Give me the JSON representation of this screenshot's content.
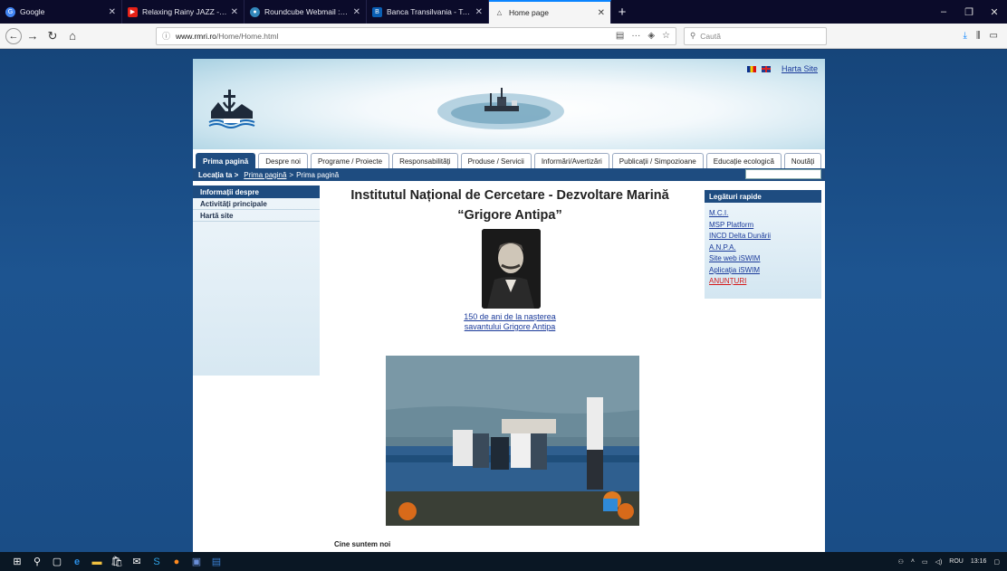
{
  "browser": {
    "tabs": [
      {
        "label": "Google",
        "icon": "google-icon",
        "color": "#4285f4",
        "active": false
      },
      {
        "label": "Relaxing Rainy JAZZ - Amaz",
        "icon": "youtube-icon",
        "color": "#e62117",
        "active": false
      },
      {
        "label": "Roundcube Webmail :: Inbox",
        "icon": "mail-icon",
        "color": "#38b",
        "active": false
      },
      {
        "label": "Banca Transilvania - Tomis No",
        "icon": "bank-icon",
        "color": "#0a5fb4",
        "active": false
      },
      {
        "label": "Home page",
        "icon": "triangle-icon",
        "color": "#333",
        "active": true
      }
    ],
    "url_host": "www.rmri.ro",
    "url_path": "/Home/Home.html",
    "search_placeholder": "Caută"
  },
  "header": {
    "harta_site": "Harta Site"
  },
  "menu": {
    "items": [
      "Prima pagină",
      "Despre noi",
      "Programe / Proiecte",
      "Responsabilități",
      "Produse / Servicii",
      "Informări/Avertizări",
      "Publicații / Simpozioane",
      "Educație ecologică",
      "Noutăți"
    ]
  },
  "location": {
    "label": "Locația ta >",
    "link": "Prima pagină",
    "sep": ">",
    "current": "Prima pagină"
  },
  "leftnav": {
    "header": "Informații despre",
    "items": [
      "Activități principale",
      "Hartă site"
    ]
  },
  "main": {
    "title_line1": "Institutul Național de Cercetare - Dezvoltare Marină",
    "title_line2": "“Grigore Antipa”",
    "caption_line1": "150 de ani de la nașterea",
    "caption_line2": "savantului Grigore Antipa",
    "section_title": "Cine suntem noi"
  },
  "rightbox": {
    "header": "Legături rapide",
    "links": [
      "M.C.I.",
      "MSP Platform",
      "INCD Delta Dunării",
      "A.N.P.A.",
      "Site web iSWIM",
      "Aplicația iSWIM",
      "ANUNȚURI"
    ]
  },
  "taskbar": {
    "lang": "ROU",
    "time": "13:16"
  }
}
